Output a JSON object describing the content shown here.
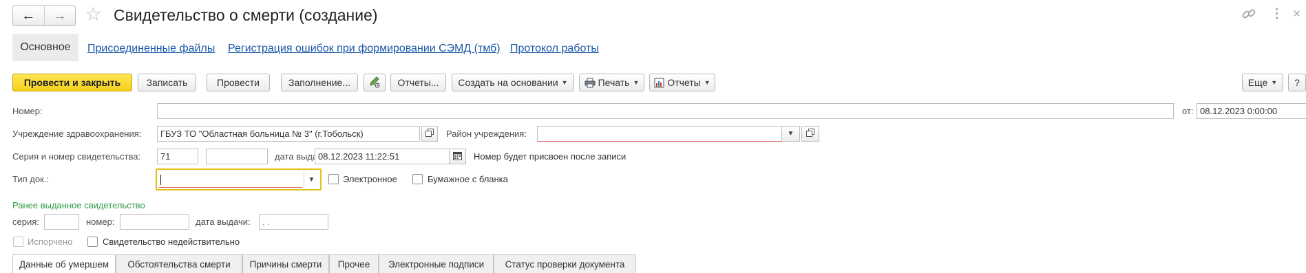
{
  "window": {
    "title": "Свидетельство о смерти (создание)"
  },
  "tabs": {
    "active": "Основное",
    "links": [
      "Присоединенные файлы",
      "Регистрация ошибок при формировании СЭМД (тмб)",
      "Протокол работы"
    ]
  },
  "toolbar": {
    "post_close": "Провести и закрыть",
    "save": "Записать",
    "post": "Провести",
    "fill": "Заполнение...",
    "reports": "Отчеты...",
    "create_based": "Создать на основании",
    "print": "Печать",
    "reports2": "Отчеты",
    "more": "Еще",
    "help": "?"
  },
  "form": {
    "number_label": "Номер:",
    "number_value": "",
    "from_label": "от:",
    "from_value": "08.12.2023  0:00:00",
    "institution_label": "Учреждение здравоохранения:",
    "institution_value": "ГБУЗ ТО \"Областная больница № 3\" (г.Тобольск)",
    "district_label": "Район учреждения:",
    "district_value": "",
    "series_label": "Серия и номер свидетельства:",
    "series_value": "71",
    "number2_value": "",
    "issue_date_label": "дата выдачи:",
    "issue_date_value": "08.12.2023 11:22:51",
    "number_note": "Номер будет присвоен после записи",
    "doc_type_label": "Тип док.:",
    "doc_type_value": "",
    "electronic_label": "Электронное",
    "paper_label": "Бумажное с бланка"
  },
  "previous": {
    "header": "Ранее выданное свидетельство",
    "series_label": "серия:",
    "number_label": "номер:",
    "date_label": "дата выдачи:",
    "date_value": " .  ."
  },
  "flags": {
    "spoiled_label": "Испорчено",
    "invalid_label": "Свидетельство недействительно"
  },
  "bottom_tabs": [
    "Данные об умершем",
    "Обстоятельства смерти",
    "Причины смерти",
    "Прочее",
    "Электронные подписи",
    "Статус проверки документа"
  ],
  "colors": {
    "primary_button": "#f4cf1b",
    "link": "#1b59a8",
    "section_header": "#2c9b43",
    "required_underline": "#e05a5a",
    "focus_border": "#e2c21a"
  }
}
